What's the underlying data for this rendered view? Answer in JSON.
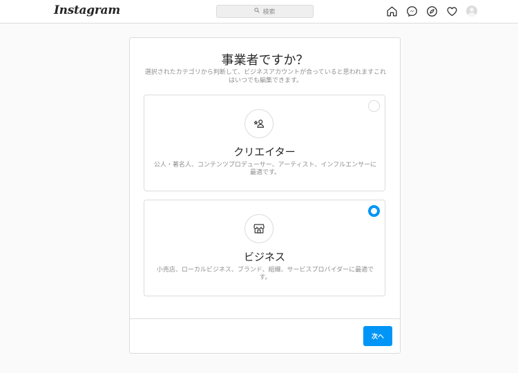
{
  "header": {
    "logo": "Instagram",
    "search_placeholder": "検索",
    "icons": [
      "home-icon",
      "messenger-icon",
      "explore-icon",
      "heart-icon",
      "avatar"
    ]
  },
  "dialog": {
    "title": "事業者ですか？",
    "subtitle": "選択されたカテゴリから判断して、ビジネスアカウントが合っていると思われますこれはいつでも編集できます。",
    "options": [
      {
        "title": "クリエイター",
        "description": "公人・著名人、コンテンツプロデューサー、アーティスト、インフルエンサーに最適です。",
        "icon": "creator-icon",
        "selected": false
      },
      {
        "title": "ビジネス",
        "description": "小売店、ローカルビジネス、ブランド、組織、サービスプロバイダーに最適です。",
        "icon": "shop-icon",
        "selected": true
      }
    ],
    "next_label": "次へ"
  },
  "colors": {
    "accent": "#0095f6",
    "border": "#dbdbdb",
    "background": "#fafafa",
    "text": "#262626",
    "muted": "#8e8e8e"
  }
}
